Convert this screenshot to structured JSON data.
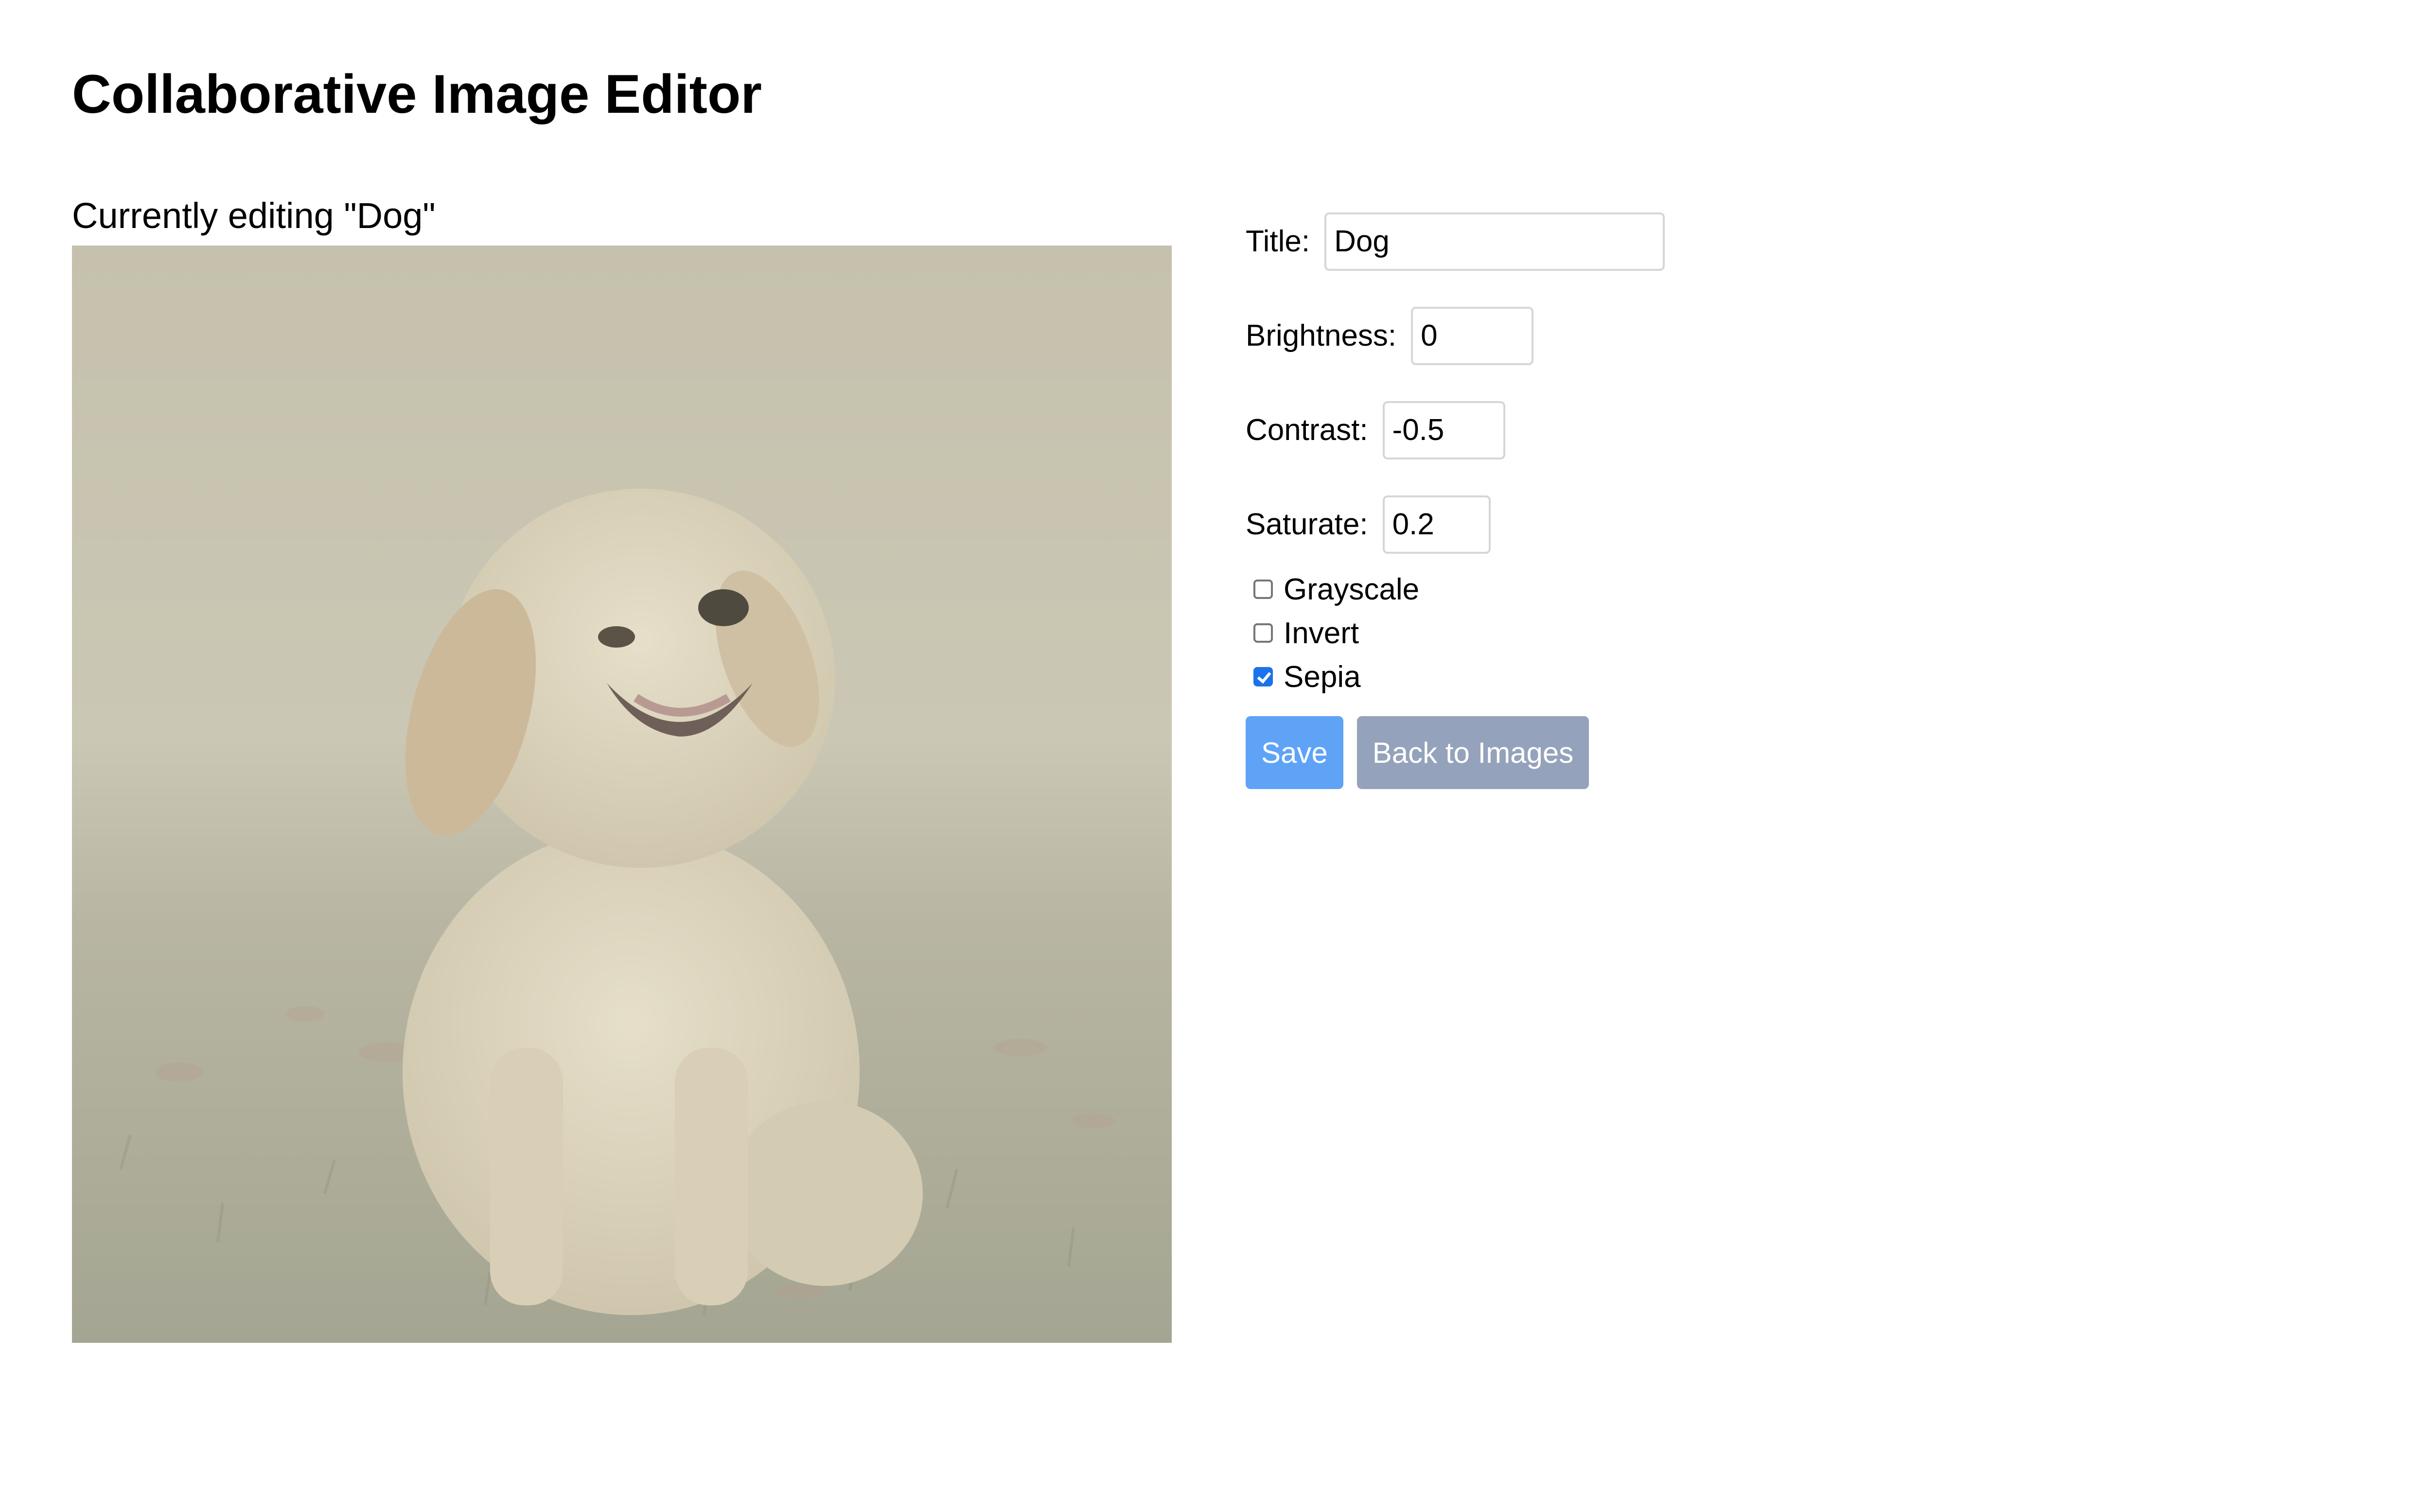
{
  "page": {
    "title": "Collaborative Image Editor"
  },
  "editing": {
    "prefix": "Currently editing ",
    "image_name_quoted": "\"Dog\""
  },
  "image": {
    "subject": "puppy sitting on grass",
    "filter_tint": "#c9c6b2"
  },
  "form": {
    "title_label": "Title:",
    "title_value": "Dog",
    "brightness_label": "Brightness:",
    "brightness_value": "0",
    "contrast_label": "Contrast:",
    "contrast_value": "-0.5",
    "saturate_label": "Saturate:",
    "saturate_value": "0.2",
    "checkboxes": [
      {
        "label": "Grayscale",
        "checked": false
      },
      {
        "label": "Invert",
        "checked": false
      },
      {
        "label": "Sepia",
        "checked": true
      }
    ]
  },
  "buttons": {
    "save_label": "Save",
    "back_label": "Back to Images",
    "save_color": "#5fa3f7",
    "back_color": "#95a2bb"
  },
  "colors": {
    "checkbox_checked": "#1a73e8"
  }
}
